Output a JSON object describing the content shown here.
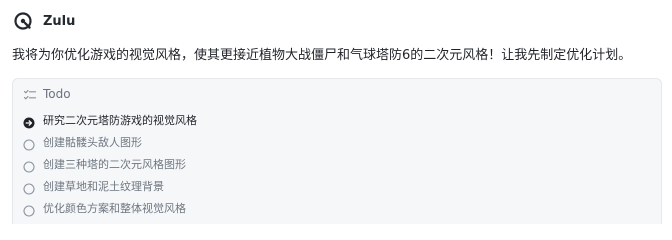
{
  "app": {
    "name": "Zulu",
    "logo_icon": "zulu-logo-icon"
  },
  "message": {
    "text": "我将为你优化游戏的视觉风格，使其更接近植物大战僵尸和气球塔防6的二次元风格！让我先制定优化计划。"
  },
  "todo": {
    "title": "Todo",
    "icon": "checklist-icon",
    "items": [
      {
        "label": "研究二次元塔防游戏的视觉风格",
        "status": "in-progress",
        "icon": "arrow-circle-icon"
      },
      {
        "label": "创建骷髅头敌人图形",
        "status": "pending",
        "icon": "empty-circle-icon"
      },
      {
        "label": "创建三种塔的二次元风格图形",
        "status": "pending",
        "icon": "empty-circle-icon"
      },
      {
        "label": "创建草地和泥土纹理背景",
        "status": "pending",
        "icon": "empty-circle-icon"
      },
      {
        "label": "优化颜色方案和整体视觉风格",
        "status": "pending",
        "icon": "empty-circle-icon"
      }
    ]
  },
  "colors": {
    "text_primary": "#1f2328",
    "text_muted": "#6e7781",
    "panel_background": "#f6f7f9",
    "panel_border": "#e6e8ec"
  }
}
